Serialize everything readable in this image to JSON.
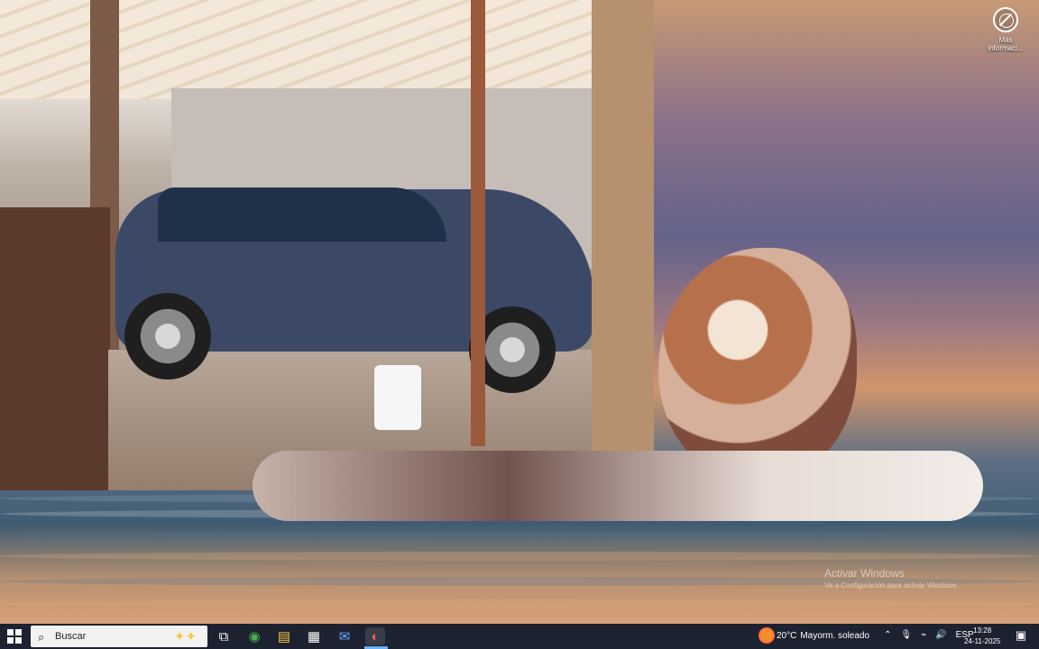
{
  "desktop": {
    "more_info_label": "Más informaci...",
    "activate_windows_title": "Activar Windows",
    "activate_windows_subtitle": "Ve a Configuración para activar Windows."
  },
  "taskbar": {
    "search_placeholder": "Buscar",
    "weather": {
      "temperature": "20°C",
      "condition": "Mayorm. soleado"
    },
    "tray": {
      "language": "ESP"
    },
    "clock": {
      "time": "13:28",
      "date": "24-11-2025"
    },
    "apps": [
      {
        "name": "task-view",
        "glyph": "⧉"
      },
      {
        "name": "chrome",
        "glyph": "◉"
      },
      {
        "name": "file-explorer",
        "glyph": "▤"
      },
      {
        "name": "store",
        "glyph": "▦"
      },
      {
        "name": "mail",
        "glyph": "✉"
      },
      {
        "name": "active-app",
        "glyph": "◐"
      }
    ]
  },
  "colors": {
    "taskbar": "#1c2230",
    "accent": "#6ab1ff"
  }
}
